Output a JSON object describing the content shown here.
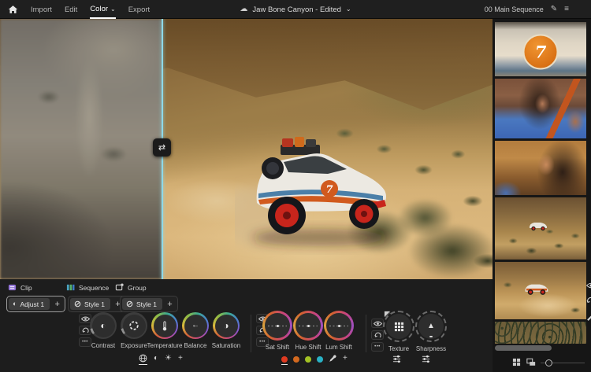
{
  "topbar": {
    "nav": {
      "import": "Import",
      "edit": "Edit",
      "color": "Color",
      "export": "Export"
    },
    "project_name": "Jaw Bone Canyon - Edited",
    "sequence_name": "00 Main Sequence"
  },
  "glyphs": {
    "chevron_down": "⌄",
    "cloud": "☁",
    "pencil": "✎",
    "menu": "≡",
    "swap": "⇄",
    "contrast": "◐",
    "saturation": "◑",
    "balance": "←",
    "sun": "☀",
    "sharpness": "▲",
    "plus": "+",
    "dots": "•••",
    "seven": "7"
  },
  "panel": {
    "tabs": {
      "clip": "Clip",
      "sequence": "Sequence",
      "group": "Group"
    },
    "presets": {
      "adjust": "Adjust 1",
      "style1": "Style 1",
      "style2": "Style 1"
    },
    "basic_dials": {
      "d0": "Contrast",
      "d1": "Exposure",
      "d2": "Temperature",
      "d3": "Balance",
      "d4": "Saturation"
    },
    "shift_dials": {
      "d0": "Sat Shift",
      "d1": "Hue Shift",
      "d2": "Lum Shift"
    },
    "detail_dials": {
      "d0": "Texture",
      "d1": "Sharpness"
    },
    "swatches": {
      "red": "#df3a20",
      "orange": "#d3691f",
      "green": "#a3c224",
      "teal": "#29b2c6"
    },
    "swatch_styles": {
      "red": "background:#df3a20",
      "orange": "background:#d3691f",
      "green": "background:#a3c224",
      "teal": "background:#29b2c6"
    }
  },
  "filmstrip": {
    "thumbnails": [
      {
        "name": "car-door-number-7"
      },
      {
        "name": "woman-blue-shirt-in-car"
      },
      {
        "name": "woman-closeup-golden-light"
      },
      {
        "name": "car-hillside-wide-shot"
      },
      {
        "name": "car-dirt-road"
      },
      {
        "name": "car-aerial-bushes"
      }
    ]
  },
  "colors": {
    "divider_accent": "#8ed9e9",
    "clip_tab_purple": "#8f6fd6",
    "panel_bg": "#1d1d1d"
  }
}
